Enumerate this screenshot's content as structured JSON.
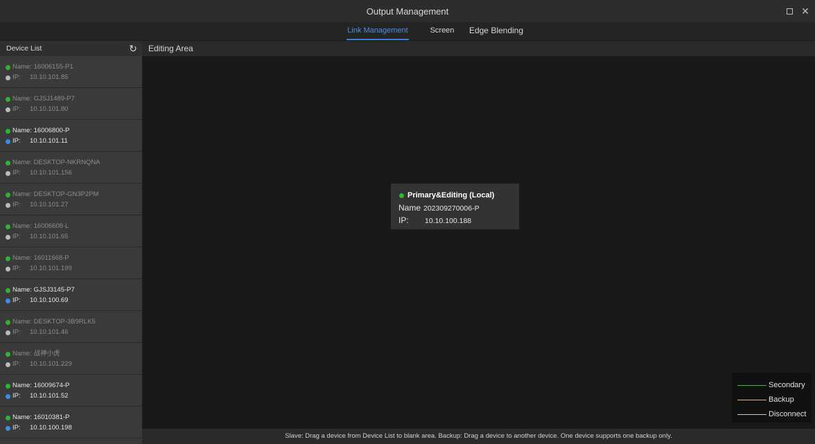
{
  "window": {
    "title": "Output Management",
    "maximize_icon": "maximize-icon",
    "close_icon": "close-icon",
    "close_glyph": "✕"
  },
  "tabs": [
    {
      "label": "Link Management",
      "active": true
    },
    {
      "label": "Screen",
      "active": false
    },
    {
      "label": "Edge Blending",
      "active": false
    }
  ],
  "sidebar": {
    "title": "Device List",
    "refresh_icon": "refresh-icon",
    "refresh_glyph": "↻",
    "devices": [
      {
        "name_label": "Name:",
        "name": "16006155-P1",
        "ip_label": "IP:",
        "ip": "10.10.101.85",
        "active": false,
        "ip_dot": "#bbbbbb"
      },
      {
        "name_label": "Name:",
        "name": "GJSJ1489-P7",
        "ip_label": "IP:",
        "ip": "10.10.101.80",
        "active": false,
        "ip_dot": "#bbbbbb"
      },
      {
        "name_label": "Name:",
        "name": "16006800-P",
        "ip_label": "IP:",
        "ip": "10.10.101.11",
        "active": true,
        "ip_dot": "#3b8ee0"
      },
      {
        "name_label": "Name:",
        "name": "DESKTOP-NKRNQNA",
        "ip_label": "IP:",
        "ip": "10.10.101.156",
        "active": false,
        "ip_dot": "#bbbbbb"
      },
      {
        "name_label": "Name:",
        "name": "DESKTOP-GN3P2PM",
        "ip_label": "IP:",
        "ip": "10.10.101.27",
        "active": false,
        "ip_dot": "#bbbbbb"
      },
      {
        "name_label": "Name:",
        "name": "16006608-L",
        "ip_label": "IP:",
        "ip": "10.10.101.65",
        "active": false,
        "ip_dot": "#bbbbbb"
      },
      {
        "name_label": "Name:",
        "name": "16011668-P",
        "ip_label": "IP:",
        "ip": "10.10.101.199",
        "active": false,
        "ip_dot": "#bbbbbb"
      },
      {
        "name_label": "Name:",
        "name": "GJSJ3145-P7",
        "ip_label": "IP:",
        "ip": "10.10.100.69",
        "active": true,
        "ip_dot": "#3b8ee0"
      },
      {
        "name_label": "Name:",
        "name": "DESKTOP-3B9RLK5",
        "ip_label": "IP:",
        "ip": "10.10.101.46",
        "active": false,
        "ip_dot": "#bbbbbb"
      },
      {
        "name_label": "Name:",
        "name": "战神小虎",
        "ip_label": "IP:",
        "ip": "10.10.101.229",
        "active": false,
        "ip_dot": "#bbbbbb"
      },
      {
        "name_label": "Name:",
        "name": "16009674-P",
        "ip_label": "IP:",
        "ip": "10.10.101.52",
        "active": true,
        "ip_dot": "#3b8ee0"
      },
      {
        "name_label": "Name:",
        "name": "16010381-P",
        "ip_label": "IP:",
        "ip": "10.10.100.198",
        "active": true,
        "ip_dot": "#3b8ee0"
      }
    ]
  },
  "editing_area": {
    "title": "Editing Area",
    "primary_card": {
      "title": "Primary&Editing (Local)",
      "name_label": "Name",
      "name": "202309270006-P",
      "ip_label": "IP:",
      "ip": "10.10.100.188",
      "status_color": "#2fb52f"
    },
    "legend": [
      {
        "label": "Secondary",
        "color": "#35c135"
      },
      {
        "label": "Backup",
        "color": "#e8b07a"
      },
      {
        "label": "Disconnect",
        "color": "#c8c8c8"
      }
    ]
  },
  "status_bar": {
    "text": "Slave: Drag a device from Device List to blank area. Backup: Drag a device to another device. One device supports one backup only."
  },
  "colors": {
    "online": "#2fb52f",
    "accent": "#3a82d8",
    "ip_active": "#3b8ee0",
    "ip_inactive": "#bbbbbb"
  }
}
